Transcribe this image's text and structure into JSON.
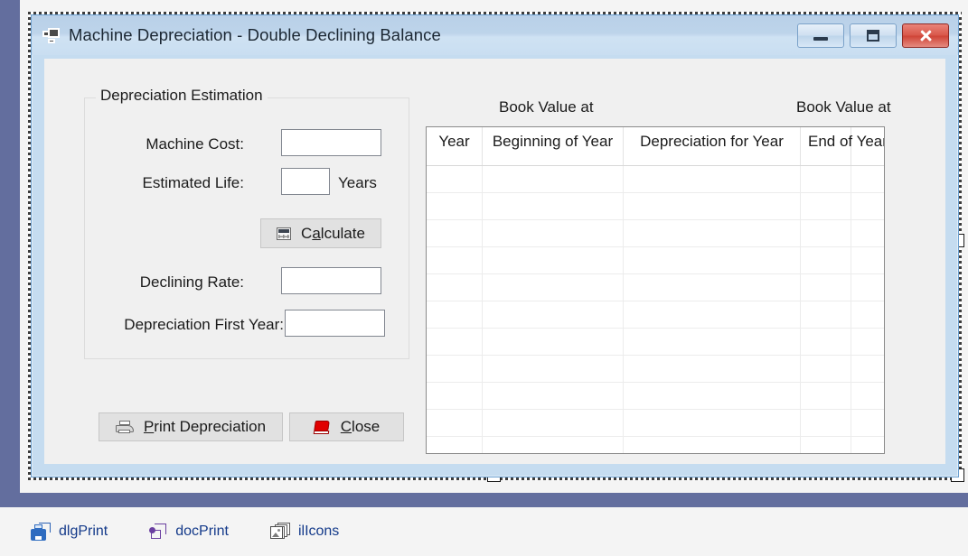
{
  "ide": {
    "component_tray": [
      {
        "name": "dlgPrint",
        "icon": "print-dialog-icon"
      },
      {
        "name": "docPrint",
        "icon": "print-document-icon"
      },
      {
        "name": "ilIcons",
        "icon": "image-list-icon"
      }
    ]
  },
  "window": {
    "title": "Machine Depreciation - Double Declining Balance",
    "icon": "form-window-icon",
    "controls": {
      "minimize": "minimize-button",
      "maximize": "maximize-button",
      "close": "close-button"
    },
    "colors": {
      "titlebar_top": "#b9d0e8",
      "titlebar_bottom": "#c9def1",
      "frame": "#c5dcf0",
      "client": "#f0f0f0",
      "close_button": "#d9584b"
    }
  },
  "form": {
    "groupbox": {
      "legend": "Depreciation Estimation",
      "fields": [
        {
          "label": "Machine Cost:",
          "value": "",
          "unit": ""
        },
        {
          "label": "Estimated Life:",
          "value": "",
          "unit": "Years"
        },
        {
          "label": "Declining Rate:",
          "value": "",
          "unit": ""
        },
        {
          "label": "Depreciation First Year:",
          "value": "",
          "unit": ""
        }
      ],
      "calculate_button": {
        "label_pre": "C",
        "label_accel": "a",
        "label_post": "lculate",
        "full": "Calculate",
        "icon": "calculator-icon"
      }
    },
    "actions": [
      {
        "label_pre": "",
        "label_accel": "P",
        "label_post": "rint Depreciation",
        "full": "Print Depreciation",
        "icon": "printer-icon"
      },
      {
        "label_pre": "",
        "label_accel": "C",
        "label_post": "lose",
        "full": "Close",
        "icon": "red-book-icon"
      }
    ],
    "grid": {
      "above_labels": [
        "Book Value at",
        "Book Value at"
      ],
      "columns": [
        "Year",
        "Beginning of Year",
        "Depreciation for Year",
        "End of Year",
        ""
      ],
      "rows": [],
      "empty_row_count": 12
    }
  }
}
